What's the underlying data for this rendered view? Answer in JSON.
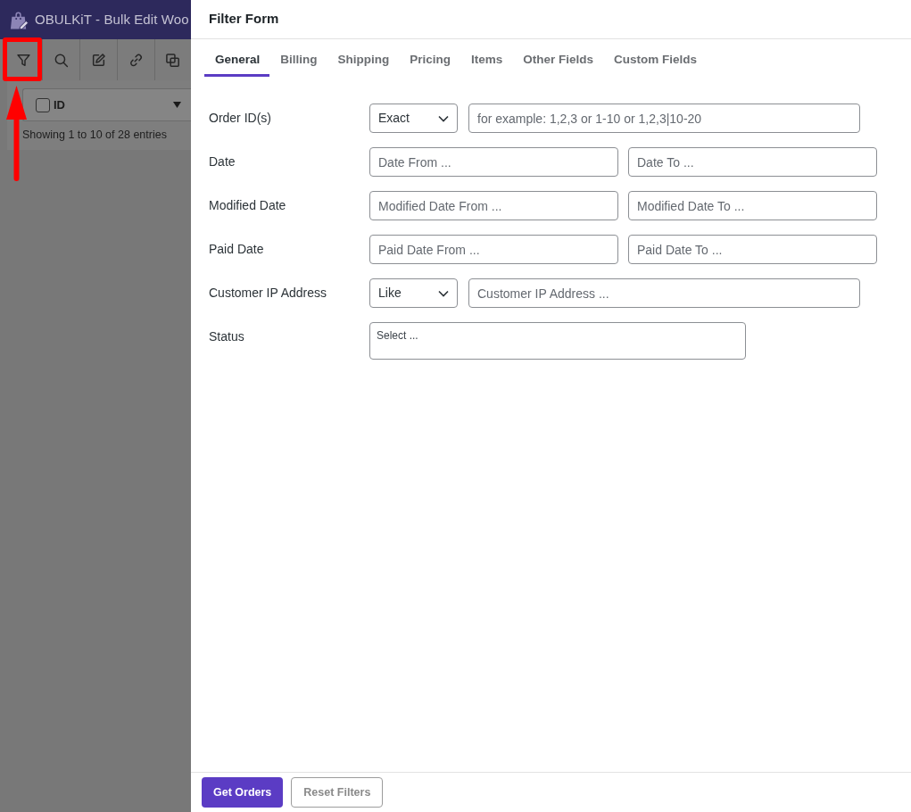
{
  "app": {
    "title": "OBULKiT - Bulk Edit Woo"
  },
  "table": {
    "columns": [
      {
        "label": "ID",
        "checked": false
      }
    ],
    "info": "Showing 1 to 10 of 28 entries"
  },
  "drawer": {
    "title": "Filter Form",
    "tabs": [
      {
        "label": "General",
        "selected": true
      },
      {
        "label": "Billing",
        "selected": false
      },
      {
        "label": "Shipping",
        "selected": false
      },
      {
        "label": "Pricing",
        "selected": false
      },
      {
        "label": "Items",
        "selected": false
      },
      {
        "label": "Other Fields",
        "selected": false
      },
      {
        "label": "Custom Fields",
        "selected": false
      }
    ],
    "fields": [
      {
        "label": "Order ID(s)",
        "kind": "operator",
        "operator": "Exact",
        "inputs": [
          {
            "placeholder": "for example: 1,2,3 or 1-10 or 1,2,3|10-20"
          }
        ]
      },
      {
        "label": "Date",
        "kind": "range",
        "inputs": [
          {
            "placeholder": "Date From ..."
          },
          {
            "placeholder": "Date To ..."
          }
        ]
      },
      {
        "label": "Modified Date",
        "kind": "range",
        "inputs": [
          {
            "placeholder": "Modified Date From ..."
          },
          {
            "placeholder": "Modified Date To ..."
          }
        ]
      },
      {
        "label": "Paid Date",
        "kind": "range",
        "inputs": [
          {
            "placeholder": "Paid Date From ..."
          },
          {
            "placeholder": "Paid Date To ..."
          }
        ]
      },
      {
        "label": "Customer IP Address",
        "kind": "operator",
        "operator": "Like",
        "inputs": [
          {
            "placeholder": "Customer IP Address ..."
          }
        ]
      },
      {
        "label": "Status",
        "kind": "multiselect",
        "inputs": [
          {
            "placeholder": "Select ..."
          }
        ]
      }
    ],
    "buttons": [
      {
        "label": "Get Orders",
        "kind": "primary"
      },
      {
        "label": "Reset Filters",
        "kind": "secondary"
      }
    ]
  }
}
